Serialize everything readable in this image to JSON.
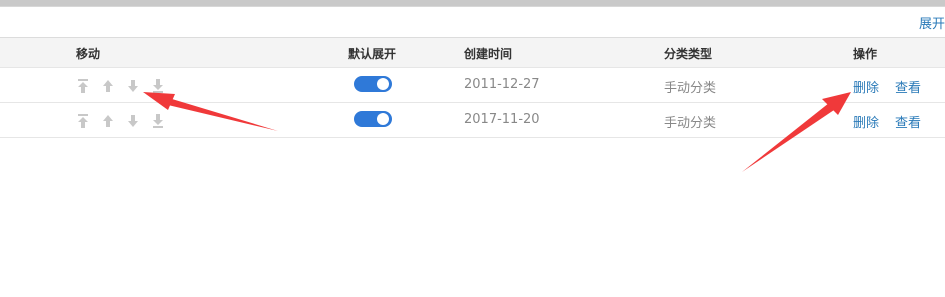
{
  "toolbar": {
    "expand_label": "展开"
  },
  "table": {
    "headers": {
      "move": "移动",
      "default_expand": "默认展开",
      "created_time": "创建时间",
      "category_type": "分类类型",
      "actions": "操作"
    },
    "rows": [
      {
        "move_icons": [
          "move-top-icon",
          "move-up-icon",
          "move-down-icon",
          "move-bottom-icon"
        ],
        "default_expand": true,
        "created_time": "2011-12-27",
        "category_type": "手动分类",
        "delete_label": "删除",
        "view_label": "查看"
      },
      {
        "move_icons": [
          "move-top-icon",
          "move-up-icon",
          "move-down-icon",
          "move-bottom-icon"
        ],
        "default_expand": true,
        "created_time": "2017-11-20",
        "category_type": "手动分类",
        "delete_label": "删除",
        "view_label": "查看"
      }
    ]
  },
  "colors": {
    "link": "#2a7ab8",
    "toggle_on": "#2f79d8",
    "icon_disabled": "#c8c8c8",
    "annotation_arrow": "#f0393a"
  },
  "annotations": [
    "arrow-pointing-at-move-icons",
    "arrow-pointing-at-delete-action"
  ]
}
